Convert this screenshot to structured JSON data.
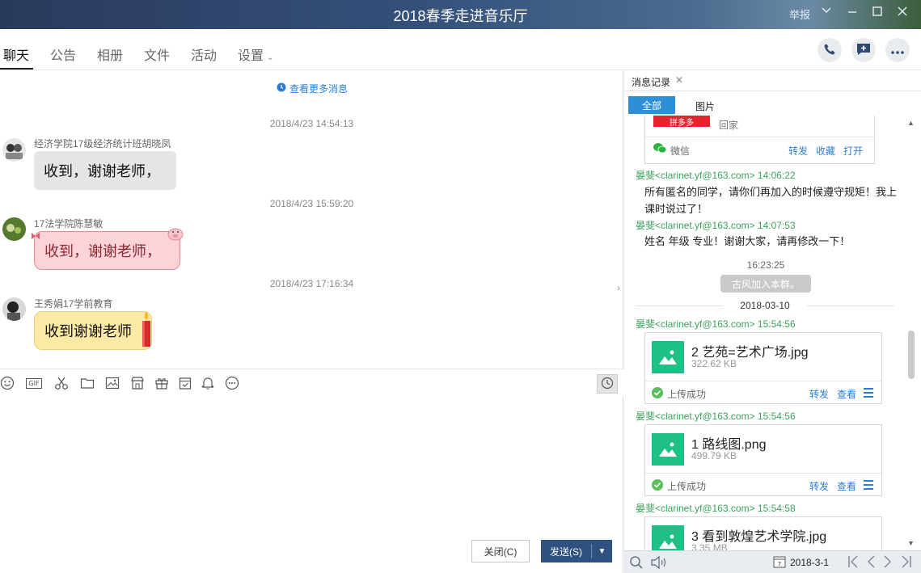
{
  "window": {
    "title": "2018春季走进音乐厅",
    "report_label": "举报"
  },
  "tabs": [
    "聊天",
    "公告",
    "相册",
    "文件",
    "活动",
    "设置"
  ],
  "chat": {
    "more_messages": "查看更多消息",
    "messages": [
      {
        "time": "2018/4/23 14:54:13",
        "sender": "经济学院17级经济统计班胡晓凤",
        "text": "收到，谢谢老师，"
      },
      {
        "time": "2018/4/23 15:59:20",
        "sender": "17法学院陈慧敏",
        "text": "收到，谢谢老师，"
      },
      {
        "time": "2018/4/23 17:16:34",
        "sender": "王秀娟17学前教育",
        "text": "收到谢谢老师"
      }
    ]
  },
  "toolbar": {
    "icons": [
      "emoji-icon",
      "gif-icon",
      "scissors-icon",
      "folder-icon",
      "image-icon",
      "shop-icon",
      "gift-icon",
      "calendar-check-icon",
      "bell-icon",
      "more-icon"
    ],
    "gif_label": "GIF"
  },
  "input": {
    "close_label": "关闭(C)",
    "send_label": "发送(S)"
  },
  "history": {
    "tab_title": "消息记录",
    "filter_all": "全部",
    "filter_images": "图片",
    "share_card": {
      "brand": "拼多多",
      "caption": "回家",
      "source": "微信",
      "forward": "转发",
      "favorite": "收藏",
      "open": "打开"
    },
    "entries": [
      {
        "name": "晏斐<clarinet.yf@163.com> 14:06:22",
        "text": "所有匿名的同学，请你们再加入的时候遵守规矩！我上课时说过了！"
      },
      {
        "name": "晏斐<clarinet.yf@163.com> 14:07:53",
        "text": "姓名 年级 专业！谢谢大家，请再修改一下！"
      }
    ],
    "time_center": "16:23:25",
    "system_pill": "古风加入本群。",
    "date_separator": "2018-03-10",
    "files": [
      {
        "name": "晏斐<clarinet.yf@163.com> 15:54:56",
        "file": "2 艺苑=艺术广场.jpg",
        "size": "322.62 KB",
        "status": "上传成功",
        "forward": "转发",
        "view": "查看"
      },
      {
        "name": "晏斐<clarinet.yf@163.com> 15:54:56",
        "file": "1 路线图.png",
        "size": "499.79 KB",
        "status": "上传成功",
        "forward": "转发",
        "view": "查看"
      },
      {
        "name": "晏斐<clarinet.yf@163.com> 15:54:58",
        "file": "3 看到敦煌艺术学院.jpg",
        "size": "3.35 MB"
      }
    ],
    "bottom_date": "2018-3-1"
  },
  "colors": {
    "accent_blue": "#2f8ed8",
    "send_button": "#2f5180",
    "sender_green": "#3aa35a",
    "file_green": "#1fbf86"
  }
}
